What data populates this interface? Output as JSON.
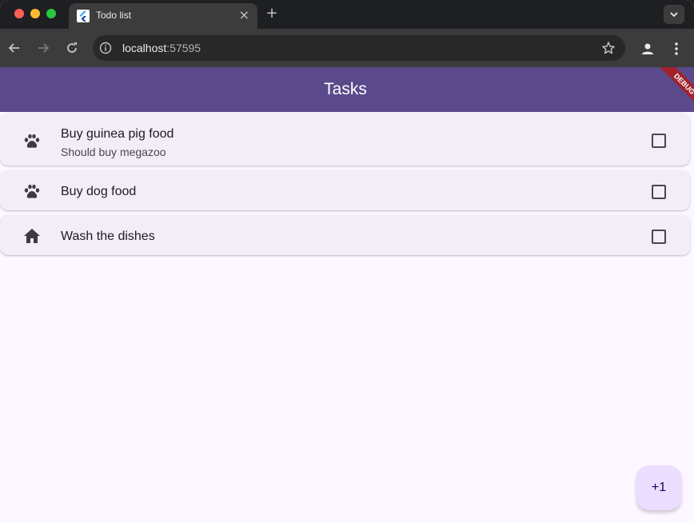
{
  "browser": {
    "tab_title": "Todo list",
    "tab_close": "×",
    "new_tab": "+",
    "url_host": "localhost",
    "url_port": ":57595"
  },
  "app": {
    "title": "Tasks",
    "debug_label": "DEBUG",
    "fab_label": "+1",
    "colors": {
      "appbar": "#5b4a8b",
      "background": "#fdf7ff",
      "card": "#f3edf7",
      "fab": "#eaddff",
      "debug_ribbon": "#a0222a"
    }
  },
  "tasks": [
    {
      "icon": "paw-icon",
      "title": "Buy guinea pig food",
      "subtitle": "Should buy megazoo",
      "checked": false
    },
    {
      "icon": "paw-icon",
      "title": "Buy dog food",
      "subtitle": "",
      "checked": false
    },
    {
      "icon": "home-icon",
      "title": "Wash the dishes",
      "subtitle": "",
      "checked": false
    }
  ]
}
